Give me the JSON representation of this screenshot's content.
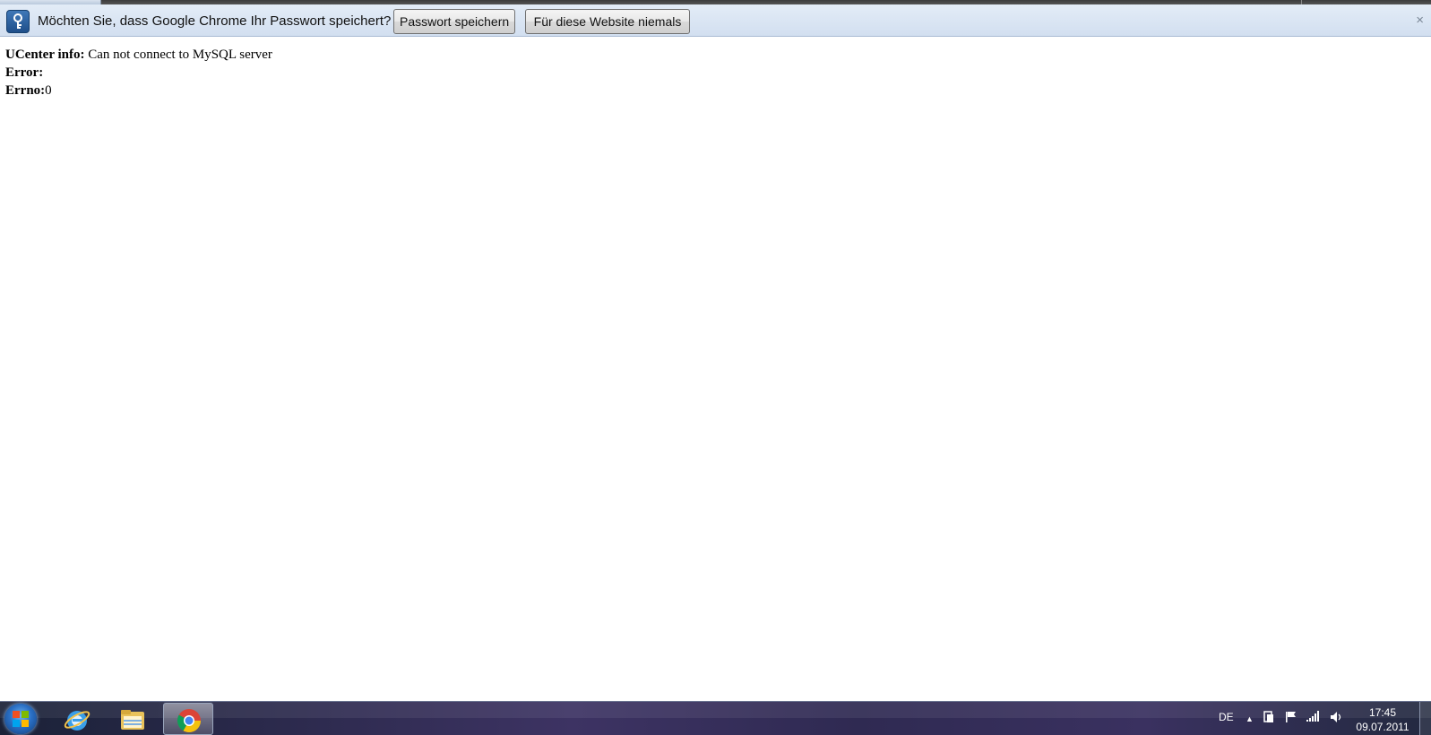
{
  "infobar": {
    "message": "Möchten Sie, dass Google Chrome Ihr Passwort speichert?",
    "save_label": "Passwort speichern",
    "never_label": "Für diese Website niemals",
    "close_glyph": "×",
    "icon": "key-icon"
  },
  "content": {
    "lines": [
      {
        "label": "UCenter info:",
        "value": " Can not connect to MySQL server"
      },
      {
        "label": "Error:",
        "value": ""
      },
      {
        "label": "Errno:",
        "value": "0"
      }
    ]
  },
  "taskbar": {
    "pinned": [
      {
        "name": "internet-explorer-icon"
      },
      {
        "name": "windows-explorer-icon"
      },
      {
        "name": "chrome-icon"
      }
    ],
    "language": "DE",
    "time": "17:45",
    "date": "09.07.2011"
  },
  "colors": {
    "infobar_bg": "#dbe6f4",
    "taskbar_bg": "#2c2a4d",
    "start_orb": "#2a6fc4"
  }
}
